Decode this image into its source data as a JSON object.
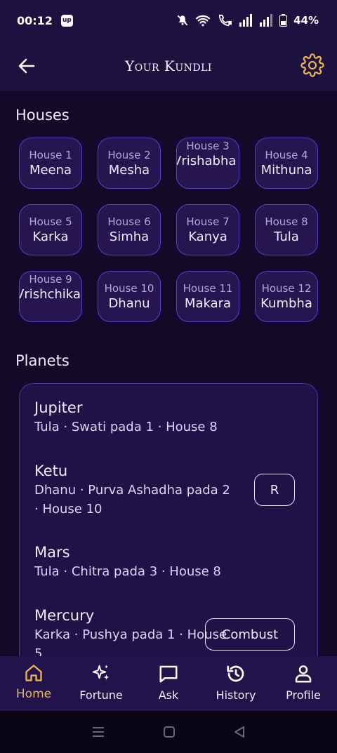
{
  "status_bar": {
    "time": "00:12",
    "app_badge": "up",
    "battery": "44%"
  },
  "app_bar": {
    "title": "Your Kundli"
  },
  "houses": {
    "title": "Houses",
    "items": [
      {
        "label": "House 1",
        "sign": "Meena"
      },
      {
        "label": "House 2",
        "sign": "Mesha"
      },
      {
        "label": "House 3",
        "sign": "Vrishabha"
      },
      {
        "label": "House 4",
        "sign": "Mithuna"
      },
      {
        "label": "House 5",
        "sign": "Karka"
      },
      {
        "label": "House 6",
        "sign": "Simha"
      },
      {
        "label": "House 7",
        "sign": "Kanya"
      },
      {
        "label": "House 8",
        "sign": "Tula"
      },
      {
        "label": "House 9",
        "sign": "Vrishchika"
      },
      {
        "label": "House 10",
        "sign": "Dhanu"
      },
      {
        "label": "House 11",
        "sign": "Makara"
      },
      {
        "label": "House 12",
        "sign": "Kumbha"
      }
    ]
  },
  "planets": {
    "title": "Planets",
    "items": [
      {
        "name": "Jupiter",
        "detail": "Tula · Swati pada 1 · House 8",
        "tag": ""
      },
      {
        "name": "Ketu",
        "detail": "Dhanu · Purva Ashadha pada 2 · House 10",
        "tag": "R"
      },
      {
        "name": "Mars",
        "detail": "Tula · Chitra pada 3 · House 8",
        "tag": ""
      },
      {
        "name": "Mercury",
        "detail": "Karka · Pushya pada 1 · House 5",
        "tag": "Combust"
      }
    ]
  },
  "bottom_nav": {
    "items": [
      {
        "label": "Home",
        "icon": "home-icon",
        "active": true
      },
      {
        "label": "Fortune",
        "icon": "sparkles-icon",
        "active": false
      },
      {
        "label": "Ask",
        "icon": "chat-icon",
        "active": false
      },
      {
        "label": "History",
        "icon": "history-icon",
        "active": false
      },
      {
        "label": "Profile",
        "icon": "person-icon",
        "active": false
      }
    ]
  },
  "colors": {
    "background": "#130a2a",
    "app_bar": "#1d1140",
    "card_border": "#5b3cc4",
    "accent": "#e8b64a"
  }
}
